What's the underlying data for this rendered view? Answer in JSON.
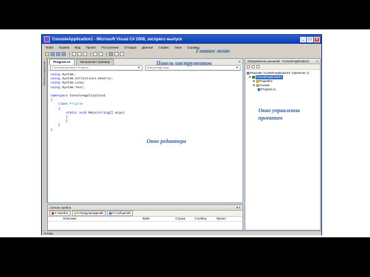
{
  "window": {
    "title": "ConsoleApplication1 - Microsoft Visual C# 2008, экспресс-выпуск",
    "controls": [
      "_",
      "□",
      "×"
    ]
  },
  "menu": [
    "Файл",
    "Правка",
    "Вид",
    "Проект",
    "Построение",
    "Отладка",
    "Данные",
    "Сервис",
    "Окно",
    "Справка"
  ],
  "annotations": {
    "main_menu": "Главное меню",
    "toolbar": "Панель инструментов",
    "editor": "Окно редактора",
    "project_window": "Окно управления проектом"
  },
  "side_strip": "Панель элементов",
  "editor": {
    "tabs": [
      "Program.cs",
      "Начальная страница"
    ],
    "nav_left": "ConsoleApplication1.Program",
    "nav_right": "Main(string[] args)",
    "code": [
      "using System;",
      "using System.Collections.Generic;",
      "using System.Linq;",
      "using System.Text;",
      "",
      "namespace ConsoleApplication1",
      "{",
      "    class Program",
      "    {",
      "        static void Main(string[] args)",
      "        {",
      "        }",
      "    }",
      "}"
    ]
  },
  "errors": {
    "title": "Список ошибок",
    "filters": [
      "0 Ошибок",
      "0 Предупреждений",
      "0 Сообщений"
    ],
    "columns": [
      "Описание",
      "Файл",
      "Строка",
      "Столбец",
      "Проект"
    ]
  },
  "solution": {
    "title": "Обозреватель решений - ConsoleApplication1",
    "tree": [
      "Решение \"ConsoleApplication1\" (проектов: 1)",
      "ConsoleApplication1",
      "Properties",
      "Ссылки",
      "Program.cs"
    ]
  },
  "status": "Готово",
  "colors": {
    "annotation": "#315fa8",
    "title_bar": "#0c3aa8",
    "keyword": "#0000ff",
    "type": "#2b91af"
  }
}
